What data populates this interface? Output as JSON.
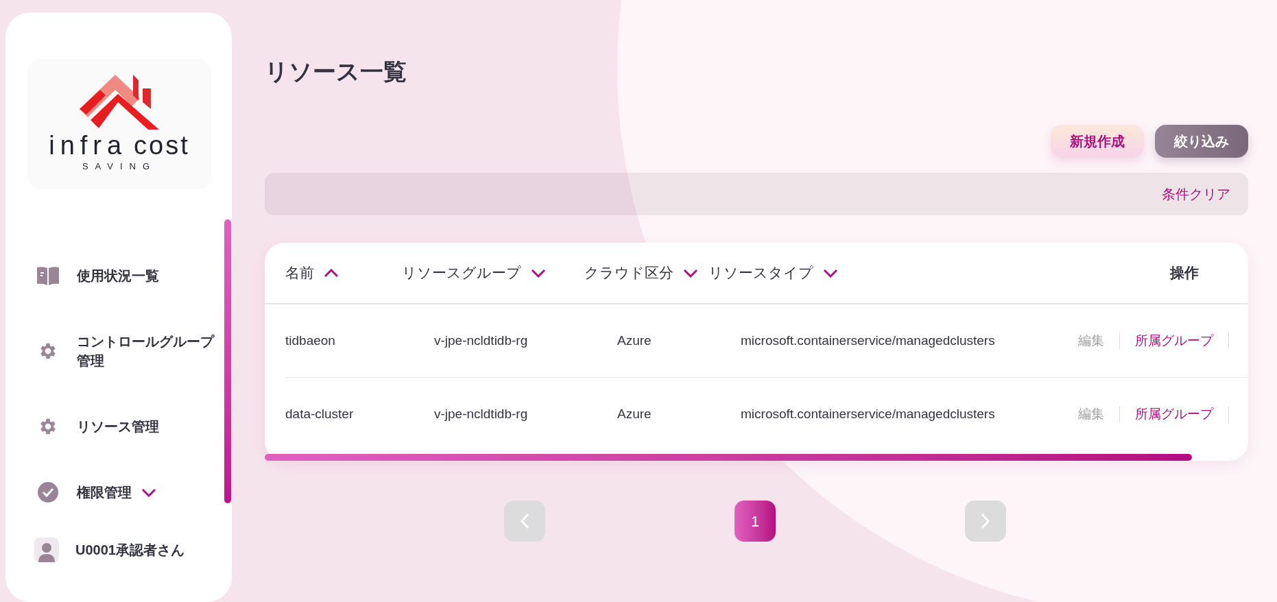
{
  "logo": {
    "word_1": "infra",
    "word_2": "cost",
    "tagline": "SAVING"
  },
  "sidebar": {
    "items": [
      {
        "kind": "book",
        "label": "使用状況一覧"
      },
      {
        "kind": "gear",
        "label": "コントロールグループ管理"
      },
      {
        "kind": "gear",
        "label": "リソース管理"
      },
      {
        "kind": "check",
        "label": "権限管理",
        "expanded": false
      }
    ],
    "user": {
      "label": "U0001承認者さん"
    }
  },
  "page": {
    "title": "リソース一覧"
  },
  "toolbar": {
    "buttons": [
      {
        "kind": "primary",
        "label": "新規作成"
      },
      {
        "kind": "secondary",
        "label": "絞り込み"
      }
    ]
  },
  "filter_bar": {
    "clear_link": "条件クリア"
  },
  "table": {
    "columns": [
      {
        "label": "名前",
        "sort_ascending": true
      },
      {
        "label": "リソースグループ",
        "sort_ascending": false
      },
      {
        "label": "クラウド区分",
        "sort_ascending": false
      },
      {
        "label": "リソースタイプ",
        "sort_ascending": false
      },
      {
        "label": "操作"
      }
    ],
    "rows": [
      {
        "cells": [
          "tidbaeon",
          "v-jpe-ncldtidb-rg",
          "Azure",
          "microsoft.containerservice/managedclusters"
        ],
        "actions": [
          {
            "label": "編集",
            "disabled": true
          },
          {
            "label": "所属グループ",
            "disabled": false
          }
        ]
      },
      {
        "cells": [
          "data-cluster",
          "v-jpe-ncldtidb-rg",
          "Azure",
          "microsoft.containerservice/managedclusters"
        ],
        "actions": [
          {
            "label": "編集",
            "disabled": true
          },
          {
            "label": "所属グループ",
            "disabled": false
          }
        ]
      }
    ]
  },
  "pagination": {
    "pages": [
      {
        "label": "1",
        "selected": true
      }
    ]
  }
}
